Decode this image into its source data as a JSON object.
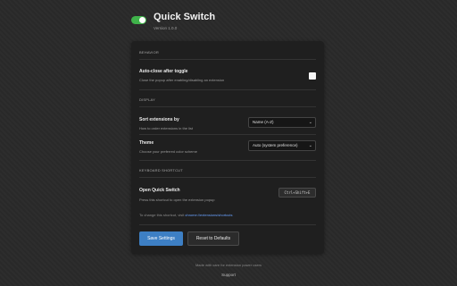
{
  "header": {
    "title": "Quick Switch",
    "version": "Version 1.0.0",
    "toggle_on": true
  },
  "sections": {
    "behavior": {
      "label": "BEHAVIOR",
      "auto_close": {
        "title": "Auto-close after toggle",
        "desc": "Close the popup after enabling/disabling an extension",
        "checked": false
      }
    },
    "display": {
      "label": "DISPLAY",
      "sort": {
        "title": "Sort extensions by",
        "desc": "How to order extensions in the list",
        "value": "Name (A-Z)"
      },
      "theme": {
        "title": "Theme",
        "desc": "Choose your preferred color scheme",
        "value": "Auto (system preference)"
      }
    },
    "shortcut": {
      "label": "KEYBOARD SHORTCUT",
      "open": {
        "title": "Open Quick Switch",
        "desc": "Press this shortcut to open the extension popup",
        "keys": "Ctrl+Shift+E"
      },
      "hint_prefix": "To change this shortcut, visit ",
      "hint_link": "chrome://extensions/shortcuts"
    }
  },
  "buttons": {
    "save": "Save Settings",
    "reset": "Reset to Defaults"
  },
  "footer": {
    "text": "Made with care for extension power users",
    "link": "Support"
  },
  "colors": {
    "toggle": "#3fb24a",
    "primary": "#3d7fc4",
    "link": "#6aa2ff"
  }
}
